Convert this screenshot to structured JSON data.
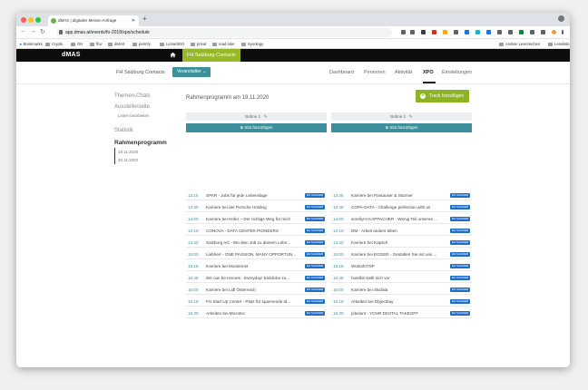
{
  "browser": {
    "tab_title": "dMAS | digitales Messe-Anfrage",
    "url": "app.dmas.at/events/fo-2018/xpo/schedule",
    "bookmarks": [
      "Bookmarks",
      "Crypto",
      "OH",
      "fhU",
      "dMAS",
      "permfy",
      "Liona/SEO",
      "privat",
      "read later",
      "Synology"
    ],
    "bookmarks_right": [
      "Andere Lesezeichen",
      "Leseliste"
    ]
  },
  "app": {
    "logo": "dMAS",
    "organization": "FH Salzburg Contacts",
    "subtitle": "FH Salzburg Contacts",
    "organizer_button": "Veranstalter ⌄",
    "nav": [
      "Dashboard",
      "Personen",
      "Aktivität",
      "XPO",
      "Einstellungen"
    ]
  },
  "side": {
    "item1": "Themen-Chats",
    "item2": "Ausstellerseite",
    "item2_sub": "Listen bearbeiten",
    "item3": "Statistik",
    "active": "Rahmenprogramm",
    "dates": [
      "19.11.2020",
      "20.11.2020"
    ]
  },
  "main": {
    "title": "Rahmenprogramm am 19.11.2020",
    "add_track": "Track hinzufügen",
    "stage1": "Bühne 1",
    "stage2": "Bühne 2",
    "add_slot": "Slot hinzufügen",
    "badge": "EN SCHWEB",
    "col1": [
      {
        "time": "13:15",
        "name": "SPAR - Jobs für jede Lebenslage"
      },
      {
        "time": "13:30",
        "name": "Karriere bei der Porsche Holding"
      },
      {
        "time": "14:00",
        "name": "Karriere bei Hofer – Der richtige Weg für mich"
      },
      {
        "time": "14:15",
        "name": "CONOVA - DATA CENTER PIONEERS"
      },
      {
        "time": "14:30",
        "name": "Salzburg AG - Wo dein Job zu deinem Lebe..."
      },
      {
        "time": "15:00",
        "name": "Liebherr - ONE PASSION. MANY OPPORTUN..."
      },
      {
        "time": "15:15",
        "name": "Karriere bei Musterinst"
      },
      {
        "time": "15:45",
        "name": "We can be Heroes - Everyday! Einblicke zu..."
      },
      {
        "time": "16:00",
        "name": "Karriere bei Lidl Österreich"
      },
      {
        "time": "16:15",
        "name": "FH Start Up Center - Platz für spannende Id..."
      },
      {
        "time": "16:30",
        "name": "Arbeiten bei Microtec"
      }
    ],
    "col2": [
      {
        "time": "13:45",
        "name": "Karriere bei Pantauser & Sturmer"
      },
      {
        "time": "13:45",
        "name": "COPA-DATA - Challenge perfection with us"
      },
      {
        "time": "14:00",
        "name": "sorellyHI KAPPACHER - Wenig Teil unseres ..."
      },
      {
        "time": "14:15",
        "name": "DM - Arbeit anders leben"
      },
      {
        "time": "14:30",
        "name": "Karriere bei Kapsch"
      },
      {
        "time": "15:00",
        "name": "Karriere bei EGGER - Gestalten Sie mit uns ..."
      },
      {
        "time": "15:15",
        "name": "WorkshITSP"
      },
      {
        "time": "15:45",
        "name": "hotelbit stellt sich vor"
      },
      {
        "time": "16:00",
        "name": "Karriere bei Skidata"
      },
      {
        "time": "16:15",
        "name": "Arbeiten bei Objectbay"
      },
      {
        "time": "16:30",
        "name": "jobelunt - YOUR DIGITAL TAKEOFF"
      }
    ]
  }
}
